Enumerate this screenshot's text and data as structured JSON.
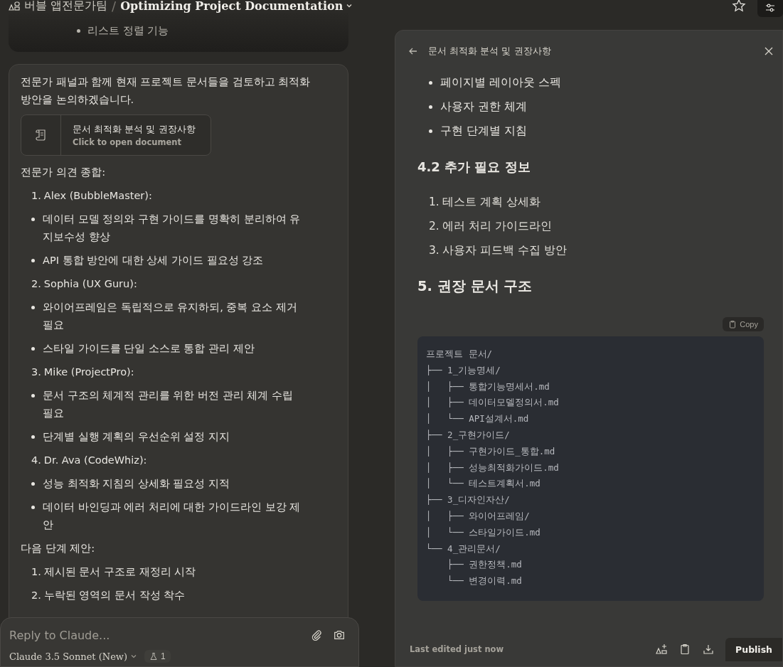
{
  "header": {
    "team": "버블 앱전문가팀",
    "separator": "/",
    "title": "Optimizing Project Documentation"
  },
  "previous_message": {
    "bullets": [
      "리스트 정렬 기능"
    ]
  },
  "message": {
    "blocks": [
      {
        "kind": "paragraph",
        "text": "전문가 패널과 함께 현재 프로젝트 문서들을 검토하고 최적화 방안을 논의하겠습니다."
      },
      {
        "kind": "document",
        "title": "문서 최적화 분석 및 권장사항",
        "subtitle": "Click to open document"
      },
      {
        "kind": "paragraph",
        "text": "전문가 의견 종합:"
      },
      {
        "kind": "numbered",
        "number": "1.",
        "text": "Alex (BubbleMaster):"
      },
      {
        "kind": "bullet",
        "text": "데이터 모델 정의와 구현 가이드를 명확히 분리하여 유지보수성 향상"
      },
      {
        "kind": "bullet",
        "text": "API 통합 방안에 대한 상세 가이드 필요성 강조"
      },
      {
        "kind": "numbered",
        "number": "2.",
        "text": "Sophia (UX Guru):"
      },
      {
        "kind": "bullet",
        "text": "와이어프레임은 독립적으로 유지하되, 중복 요소 제거 필요"
      },
      {
        "kind": "bullet",
        "text": "스타일 가이드를 단일 소스로 통합 관리 제안"
      },
      {
        "kind": "numbered",
        "number": "3.",
        "text": "Mike (ProjectPro):"
      },
      {
        "kind": "bullet",
        "text": "문서 구조의 체계적 관리를 위한 버전 관리 체계 수립 필요"
      },
      {
        "kind": "bullet",
        "text": "단계별 실행 계획의 우선순위 설정 지지"
      },
      {
        "kind": "numbered",
        "number": "4.",
        "text": "Dr. Ava (CodeWhiz):"
      },
      {
        "kind": "bullet",
        "text": "성능 최적화 지침의 상세화 필요성 지적"
      },
      {
        "kind": "bullet",
        "text": "데이터 바인딩과 에러 처리에 대한 가이드라인 보강 제안"
      },
      {
        "kind": "paragraph",
        "text": "다음 단계 제안:"
      },
      {
        "kind": "numbered",
        "number": "1.",
        "text": "제시된 문서 구조로 재정리 시작"
      },
      {
        "kind": "numbered",
        "number": "2.",
        "text": "누락된 영역의 문서 작성 착수"
      }
    ]
  },
  "composer": {
    "placeholder": "Reply to Claude...",
    "model": "Claude 3.5 Sonnet (New)",
    "badge": "1"
  },
  "artifact": {
    "title": "문서 최적화 분석 및 권장사항",
    "blocks": [
      {
        "kind": "bullet",
        "text": "페이지별 레이아웃 스펙"
      },
      {
        "kind": "bullet",
        "text": "사용자 권한 체계"
      },
      {
        "kind": "bullet",
        "text": "구현 단계별 지침"
      },
      {
        "kind": "h3",
        "text": "4.2 추가 필요 정보"
      },
      {
        "kind": "numbered",
        "number": "1.",
        "text": "테스트 계획 상세화"
      },
      {
        "kind": "numbered",
        "number": "2.",
        "text": "에러 처리 가이드라인"
      },
      {
        "kind": "numbered",
        "number": "3.",
        "text": "사용자 피드백 수집 방안"
      },
      {
        "kind": "h2",
        "text": "5. 권장 문서 구조"
      }
    ],
    "copy_label": "Copy",
    "code_lines": [
      "프로젝트 문서/",
      "├── 1_기능명세/",
      "│   ├── 통합기능명세서.md",
      "│   ├── 데이터모델정의서.md",
      "│   └── API설계서.md",
      "├── 2_구현가이드/",
      "│   ├── 구현가이드_통합.md",
      "│   ├── 성능최적화가이드.md",
      "│   └── 테스트계획서.md",
      "├── 3_디자인자산/",
      "│   ├── 와이어프레임/",
      "│   └── 스타일가이드.md",
      "└── 4_관리문서/",
      "    ├── 권한정책.md",
      "    └── 변경이력.md"
    ],
    "status": "Last edited just now",
    "publish": "Publish"
  }
}
